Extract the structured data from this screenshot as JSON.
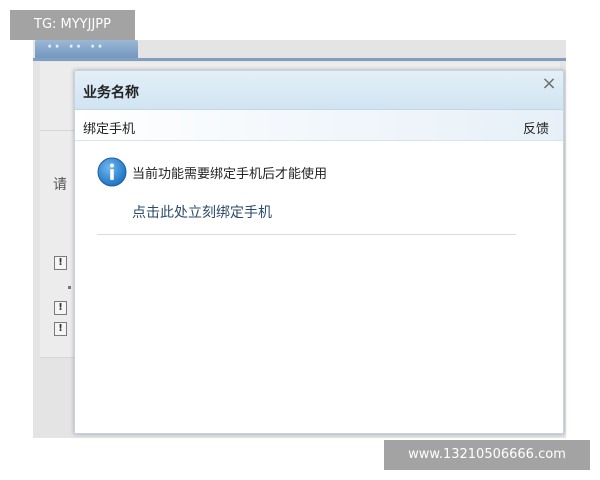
{
  "watermarks": {
    "top_left": "TG: MYYJJPP",
    "bottom_right": "www.13210506666.com"
  },
  "background": {
    "label": "请"
  },
  "dialog": {
    "title": "业务名称",
    "close_glyph": "×",
    "subbar_left": "绑定手机",
    "subbar_right": "反馈",
    "message": "当前功能需要绑定手机后才能使用",
    "bind_link": "点击此处立刻绑定手机",
    "icon": "info-icon"
  },
  "colors": {
    "header_bg": "#d9e9f5",
    "info_icon": "#2b86d4",
    "link": "#2b4b6b"
  }
}
